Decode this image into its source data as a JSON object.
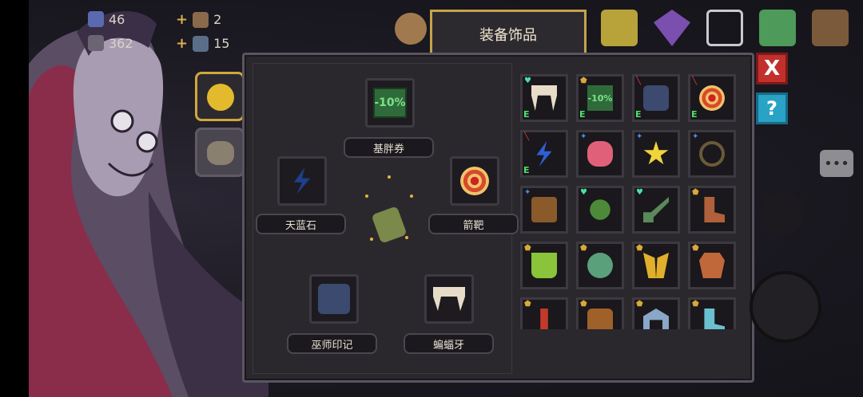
{
  "header": {
    "tab_title": "装备饰品",
    "stats": [
      {
        "name": "gem",
        "value": "46"
      },
      {
        "name": "coin",
        "value": "362"
      }
    ],
    "materials": [
      {
        "name": "material-a",
        "value": "2"
      },
      {
        "name": "material-b",
        "value": "15"
      }
    ]
  },
  "equipped": {
    "top": {
      "label": "基胖券",
      "icon": "percent-ticket-icon"
    },
    "left": {
      "label": "天蓝石",
      "icon": "lightning-stone-icon"
    },
    "right": {
      "label": "箭靶",
      "icon": "target-icon"
    },
    "bottom_left": {
      "label": "巫师印记",
      "icon": "wizard-mark-icon"
    },
    "bottom_right": {
      "label": "蝙蝠牙",
      "icon": "bat-fang-icon"
    },
    "center": {
      "icon": "pet-mummy-icon"
    }
  },
  "inventory": [
    {
      "icon": "bat-fang-icon",
      "mark": "heart",
      "equipped": "E"
    },
    {
      "icon": "percent-ticket-icon",
      "mark": "shield",
      "equipped": "E"
    },
    {
      "icon": "wizard-mark-icon",
      "mark": "slash",
      "equipped": "E"
    },
    {
      "icon": "target-icon",
      "mark": "slash",
      "equipped": "E"
    },
    {
      "icon": "lightning-stone-icon",
      "mark": "slash",
      "equipped": "E"
    },
    {
      "icon": "meat-icon",
      "mark": "star",
      "equipped": ""
    },
    {
      "icon": "star-icon",
      "mark": "star",
      "equipped": ""
    },
    {
      "icon": "skull-necklace-icon",
      "mark": "star",
      "equipped": ""
    },
    {
      "icon": "backpack-icon",
      "mark": "star",
      "equipped": ""
    },
    {
      "icon": "clover-icon",
      "mark": "heart",
      "equipped": ""
    },
    {
      "icon": "shovel-icon",
      "mark": "heart",
      "equipped": ""
    },
    {
      "icon": "boot-icon",
      "mark": "shield",
      "equipped": ""
    },
    {
      "icon": "potion-icon",
      "mark": "shield",
      "equipped": ""
    },
    {
      "icon": "snake-jar-icon",
      "mark": "shield",
      "equipped": ""
    },
    {
      "icon": "golden-wings-icon",
      "mark": "shield",
      "equipped": ""
    },
    {
      "icon": "leather-armor-icon",
      "mark": "shield",
      "equipped": ""
    },
    {
      "icon": "red-figure-icon",
      "mark": "shield",
      "equipped": ""
    },
    {
      "icon": "gauntlet-icon",
      "mark": "shield",
      "equipped": ""
    },
    {
      "icon": "arch-icon",
      "mark": "shield",
      "equipped": ""
    },
    {
      "icon": "ice-boot-icon",
      "mark": "shield",
      "equipped": ""
    }
  ],
  "colors": {
    "gold": "#c5a34a",
    "equipped_green": "#4be26a",
    "close_red": "#c2302d",
    "help_blue": "#2aa2c6"
  },
  "buttons": {
    "close": "X",
    "help": "?"
  }
}
